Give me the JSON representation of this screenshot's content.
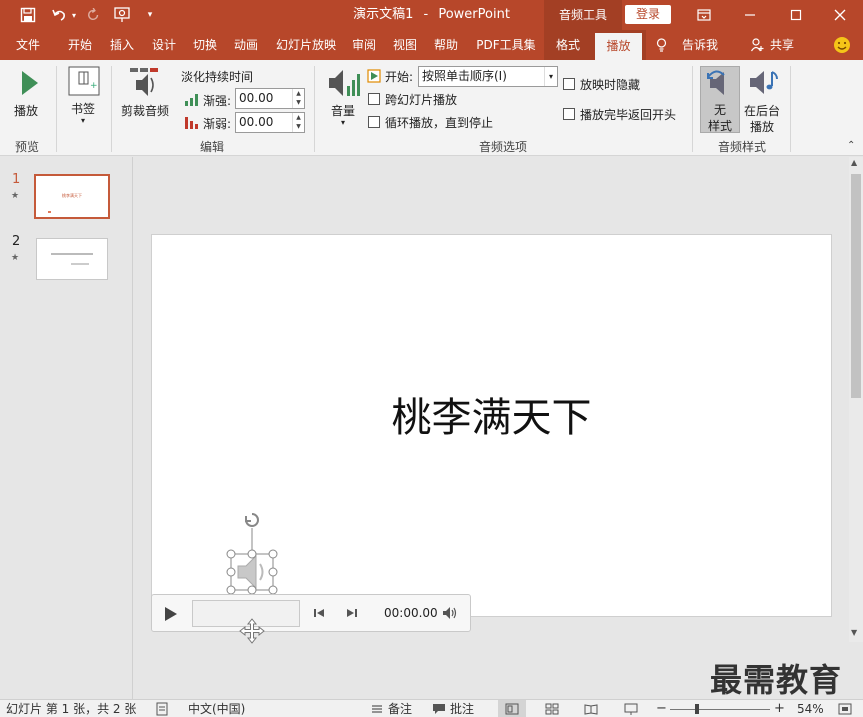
{
  "titlebar": {
    "doc_title": "演示文稿1",
    "separator": "-",
    "app_name": "PowerPoint",
    "context_tools": "音频工具",
    "login": "登录"
  },
  "tabs": [
    "文件",
    "开始",
    "插入",
    "设计",
    "切换",
    "动画",
    "幻灯片放映",
    "审阅",
    "视图",
    "帮助",
    "PDF工具集",
    "格式",
    "播放"
  ],
  "tell_me": "告诉我",
  "share": "共享",
  "ribbon": {
    "preview": {
      "play_label": "播放",
      "group": "预览"
    },
    "bookmark": {
      "label": "书签"
    },
    "editing": {
      "trim_label": "剪裁音频",
      "fade_title": "淡化持续时间",
      "fade_in_label": "渐强:",
      "fade_in_value": "00.00",
      "fade_out_label": "渐弱:",
      "fade_out_value": "00.00",
      "group": "编辑"
    },
    "audio_options": {
      "volume_label": "音量",
      "start_label": "开始:",
      "start_value": "按照单击顺序(I)",
      "cross_slides": "跨幻灯片播放",
      "loop": "循环播放，直到停止",
      "hide_during_show": "放映时隐藏",
      "rewind": "播放完毕返回开头",
      "group": "音频选项"
    },
    "audio_styles": {
      "no_style_line1": "无",
      "no_style_line2": "样式",
      "bg_line1": "在后台",
      "bg_line2": "播放",
      "group": "音频样式"
    }
  },
  "thumbnails": [
    {
      "number": "1",
      "text": "桃李满天下",
      "selected": true
    },
    {
      "number": "2",
      "text": "",
      "selected": false
    }
  ],
  "slide": {
    "title": "桃李满天下"
  },
  "player": {
    "time": "00:00.00"
  },
  "statusbar": {
    "slide_info": "幻灯片 第 1 张，共 2 张",
    "language": "中文(中国)",
    "notes": "备注",
    "comments": "批注",
    "zoom": "54%"
  },
  "watermark": "最需教育",
  "colors": {
    "accent": "#b7472a",
    "accent_dark": "#a33f24",
    "ribbon_bg": "#f3f3f3"
  }
}
